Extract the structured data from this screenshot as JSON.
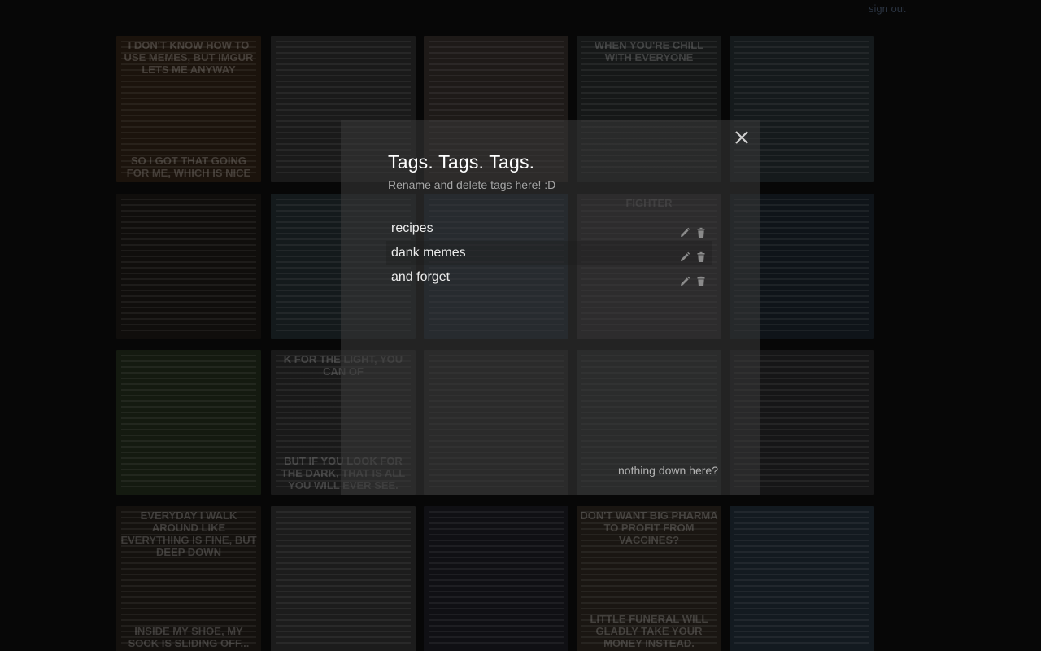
{
  "page": {
    "top_link": "sign out"
  },
  "background_tiles": [
    {
      "caption_top": "I don't know how to use memes, but imgur lets me anyway",
      "caption_bottom": "So I got that going for me, which is nice"
    },
    {
      "caption_top": "",
      "caption_bottom": ""
    },
    {
      "caption_top": "",
      "caption_bottom": ""
    },
    {
      "caption_top": "When you're chill with everyone",
      "caption_bottom": ""
    },
    {
      "caption_top": "",
      "caption_bottom": ""
    },
    {
      "caption_top": "",
      "caption_bottom": ""
    },
    {
      "caption_top": "",
      "caption_bottom": ""
    },
    {
      "caption_top": "",
      "caption_bottom": ""
    },
    {
      "caption_top": "Fighter",
      "caption_bottom": ""
    },
    {
      "caption_top": "",
      "caption_bottom": ""
    },
    {
      "caption_top": "",
      "caption_bottom": ""
    },
    {
      "caption_top": "k for the light, you can of",
      "caption_bottom": "But if you look for the dark, that is all you will ever see."
    },
    {
      "caption_top": "",
      "caption_bottom": ""
    },
    {
      "caption_top": "",
      "caption_bottom": ""
    },
    {
      "caption_top": "",
      "caption_bottom": ""
    },
    {
      "caption_top": "Everyday I walk around like everything is fine, but deep down",
      "caption_bottom": "Inside my shoe, my sock is sliding off..."
    },
    {
      "caption_top": "",
      "caption_bottom": ""
    },
    {
      "caption_top": "",
      "caption_bottom": ""
    },
    {
      "caption_top": "Don't want Big Pharma to profit from vaccines?",
      "caption_bottom": "Little Funeral will gladly take your money instead."
    },
    {
      "caption_top": "",
      "caption_bottom": ""
    }
  ],
  "modal": {
    "title": "Tags. Tags. Tags.",
    "subtitle": "Rename and delete tags here! :D",
    "close_icon": "close-icon",
    "tags": [
      {
        "name": "recipes"
      },
      {
        "name": "dank memes"
      },
      {
        "name": "and forget"
      }
    ],
    "footer": "nothing down here?"
  },
  "colors": {
    "modal_bg": "#2e2e2e",
    "title": "#ffffff",
    "subtitle": "#a6a6a6",
    "tag_text": "#ececec",
    "icon": "#8a8a8a"
  }
}
